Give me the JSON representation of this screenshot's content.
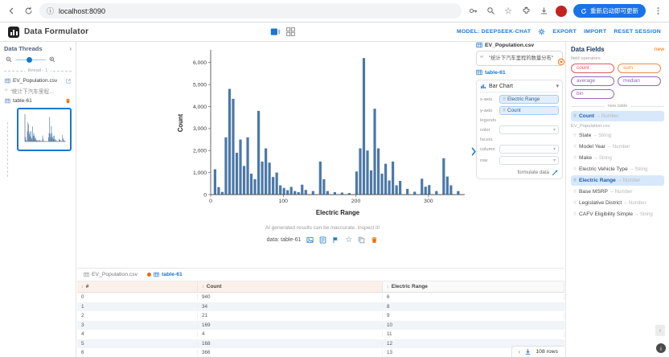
{
  "browser": {
    "url": "localhost:8090",
    "update_button": "重新启动即可更新"
  },
  "header": {
    "app_title": "Data Formulator",
    "model_link": "MODEL: DEEPSEEK-CHAT",
    "export_link": "EXPORT",
    "import_link": "IMPORT",
    "reset_link": "RESET SESSION"
  },
  "threads": {
    "title": "Data Threads",
    "thread_label": "thread - 1",
    "items": [
      {
        "label": "EV_Population.csv"
      },
      {
        "label": "\"统计下汽车里程的数量分布\""
      },
      {
        "label": "table-61"
      }
    ]
  },
  "main": {
    "disclaimer": "AI generated results can be inaccurate, inspect it!",
    "data_label": "data: table-61"
  },
  "config": {
    "dataset": "EV_Population.csv",
    "prompt": "\"统计下汽车里程的数量分布\"",
    "derived_table": "table-61",
    "chart_type": "Bar Chart",
    "encodings": {
      "x": {
        "label": "x-axis",
        "value": "Electric Range"
      },
      "y": {
        "label": "y-axis",
        "value": "Count"
      },
      "legends_label": "legends",
      "color": {
        "label": "color",
        "value": ""
      },
      "facets_label": "facets",
      "column": {
        "label": "column",
        "value": ""
      },
      "row": {
        "label": "row",
        "value": ""
      }
    },
    "formulate_label": "formulate data"
  },
  "fields_panel": {
    "title": "Data Fields",
    "new_label": "new",
    "operators_label": "field operators",
    "operators": [
      {
        "label": "count",
        "color": "#e0595c"
      },
      {
        "label": "sum",
        "color": "#ef8b47"
      },
      {
        "label": "average",
        "color": "#9467bd"
      },
      {
        "label": "median",
        "color": "#9467bd"
      },
      {
        "label": "bin",
        "color": "#9467bd"
      }
    ],
    "new_table_label": "new table",
    "dataset_label": "EV_Population.csv",
    "fields": [
      {
        "name": "Count",
        "type": "-- Number",
        "highlight": true
      },
      {
        "name": "State",
        "type": "-- String",
        "highlight": false
      },
      {
        "name": "Model Year",
        "type": "-- Number",
        "highlight": false
      },
      {
        "name": "Make",
        "type": "-- String",
        "highlight": false
      },
      {
        "name": "Electric Vehicle Type",
        "type": "-- String",
        "highlight": false
      },
      {
        "name": "Electric Range",
        "type": "-- Number",
        "highlight": true
      },
      {
        "name": "Base MSRP",
        "type": "-- Number",
        "highlight": false
      },
      {
        "name": "Legislative District",
        "type": "-- Number",
        "highlight": false
      },
      {
        "name": "CAFV Eligibility Simple",
        "type": "-- String",
        "highlight": false
      }
    ]
  },
  "table": {
    "tabs": [
      {
        "label": "EV_Population.csv",
        "active": false
      },
      {
        "label": "table-61",
        "active": true
      }
    ],
    "columns": [
      "#",
      "Count",
      "Electric Range"
    ],
    "rows": [
      [
        "0",
        "940",
        "6"
      ],
      [
        "1",
        "34",
        "8"
      ],
      [
        "2",
        "21",
        "9"
      ],
      [
        "3",
        "169",
        "10"
      ],
      [
        "4",
        "4",
        "11"
      ],
      [
        "5",
        "168",
        "12"
      ],
      [
        "6",
        "366",
        "13"
      ]
    ],
    "row_count": "108 rows"
  },
  "chart_data": {
    "type": "bar",
    "title": "",
    "xlabel": "Electric Range",
    "ylabel": "Count",
    "xlim": [
      0,
      350
    ],
    "ylim": [
      0,
      6500
    ],
    "xticks": [
      0,
      100,
      200,
      300
    ],
    "yticks": [
      0,
      1000,
      2000,
      3000,
      4000,
      5000,
      6000
    ],
    "legend": "none",
    "bars": [
      [
        6,
        1150
      ],
      [
        11,
        340
      ],
      [
        16,
        120
      ],
      [
        21,
        2600
      ],
      [
        26,
        4800
      ],
      [
        31,
        4350
      ],
      [
        36,
        1900
      ],
      [
        41,
        2500
      ],
      [
        46,
        1300
      ],
      [
        51,
        2600
      ],
      [
        56,
        950
      ],
      [
        61,
        700
      ],
      [
        66,
        3800
      ],
      [
        71,
        1500
      ],
      [
        76,
        2100
      ],
      [
        81,
        1450
      ],
      [
        86,
        800
      ],
      [
        91,
        1000
      ],
      [
        96,
        420
      ],
      [
        101,
        300
      ],
      [
        106,
        200
      ],
      [
        111,
        350
      ],
      [
        116,
        160
      ],
      [
        121,
        110
      ],
      [
        126,
        450
      ],
      [
        131,
        210
      ],
      [
        141,
        160
      ],
      [
        151,
        1500
      ],
      [
        156,
        700
      ],
      [
        161,
        160
      ],
      [
        171,
        110
      ],
      [
        181,
        90
      ],
      [
        191,
        70
      ],
      [
        201,
        1050
      ],
      [
        206,
        2100
      ],
      [
        211,
        6200
      ],
      [
        216,
        2000
      ],
      [
        221,
        1100
      ],
      [
        226,
        3900
      ],
      [
        231,
        2100
      ],
      [
        236,
        950
      ],
      [
        241,
        1400
      ],
      [
        246,
        640
      ],
      [
        251,
        1500
      ],
      [
        256,
        420
      ],
      [
        261,
        620
      ],
      [
        271,
        260
      ],
      [
        281,
        130
      ],
      [
        291,
        720
      ],
      [
        296,
        360
      ],
      [
        301,
        430
      ],
      [
        311,
        160
      ],
      [
        321,
        1650
      ],
      [
        326,
        820
      ],
      [
        331,
        420
      ],
      [
        341,
        160
      ]
    ]
  },
  "colors": {
    "accent": "#1976d2",
    "bar": "#4c78a8",
    "warn": "#ed6c02"
  }
}
